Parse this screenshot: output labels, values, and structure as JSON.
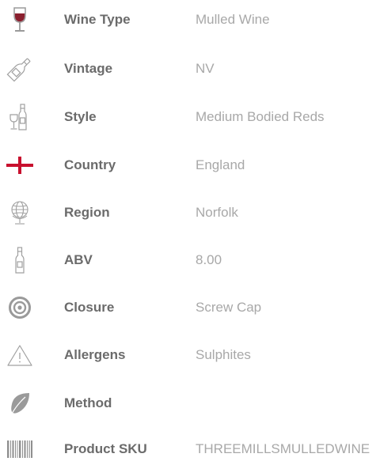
{
  "specs": [
    {
      "icon": "wine-glass-icon",
      "label": "Wine Type",
      "value": "Mulled Wine"
    },
    {
      "icon": "bottle-icon",
      "label": "Vintage",
      "value": "NV"
    },
    {
      "icon": "bottle-and-glass-icon",
      "label": "Style",
      "value": "Medium Bodied Reds"
    },
    {
      "icon": "england-flag-icon",
      "label": "Country",
      "value": "England"
    },
    {
      "icon": "globe-icon",
      "label": "Region",
      "value": "Norfolk"
    },
    {
      "icon": "small-bottle-icon",
      "label": "ABV",
      "value": "8.00"
    },
    {
      "icon": "closure-ring-icon",
      "label": "Closure",
      "value": "Screw Cap"
    },
    {
      "icon": "warning-icon",
      "label": "Allergens",
      "value": "Sulphites"
    },
    {
      "icon": "leaf-icon",
      "label": "Method",
      "value": ""
    },
    {
      "icon": "barcode-icon",
      "label": "Product SKU",
      "value": "THREEMILLSMULLEDWINE"
    }
  ],
  "colors": {
    "label": "#6b6b6b",
    "value": "#a8a8a8",
    "icon": "#9a9a9a",
    "wine": "#8a1f2e",
    "flag_red": "#c8102e"
  }
}
